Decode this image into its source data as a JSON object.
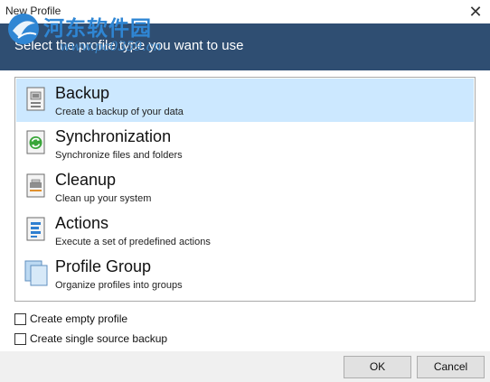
{
  "window": {
    "title": "New Profile",
    "close_glyph": "✕"
  },
  "header": {
    "text": "Select the profile type you want to use"
  },
  "watermark": {
    "title": "河东软件园",
    "url": "www.pc0359.cn"
  },
  "profile_types": [
    {
      "name": "Backup",
      "description": "Create a backup of your data",
      "icon": "backup-icon",
      "selected": true
    },
    {
      "name": "Synchronization",
      "description": "Synchronize files and folders",
      "icon": "sync-icon",
      "selected": false
    },
    {
      "name": "Cleanup",
      "description": "Clean up your system",
      "icon": "cleanup-icon",
      "selected": false
    },
    {
      "name": "Actions",
      "description": "Execute a set of predefined actions",
      "icon": "actions-icon",
      "selected": false
    },
    {
      "name": "Profile Group",
      "description": "Organize profiles into groups",
      "icon": "profile-group-icon",
      "selected": false
    }
  ],
  "options": [
    {
      "label": "Create empty profile",
      "checked": false
    },
    {
      "label": "Create single source backup",
      "checked": false
    }
  ],
  "buttons": {
    "ok": "OK",
    "cancel": "Cancel"
  },
  "colors": {
    "banner": "#2f4e72",
    "selection": "#cce8ff",
    "footer": "#f0f0f0"
  }
}
